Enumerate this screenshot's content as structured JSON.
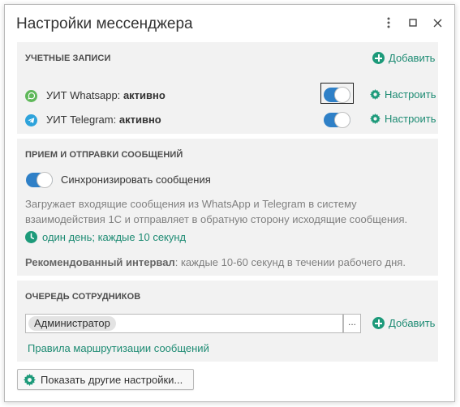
{
  "window": {
    "title": "Настройки мессенджера"
  },
  "accounts": {
    "section_title": "УЧЕТНЫЕ ЗАПИСИ",
    "add_label": "Добавить",
    "items": [
      {
        "label": "УИТ Whatsapp:",
        "status": "активно",
        "configure_label": "Настроить",
        "enabled": true,
        "icon": "whatsapp-icon",
        "icon_color": "#5fb85a"
      },
      {
        "label": "УИТ Telegram:",
        "status": "активно",
        "configure_label": "Настроить",
        "enabled": true,
        "icon": "telegram-icon",
        "icon_color": "#2ea3db"
      }
    ]
  },
  "messages": {
    "section_title": "ПРИЕМ И ОТПРАВКИ СООБЩЕНИЙ",
    "sync_label": "Синхронизировать сообщения",
    "sync_enabled": true,
    "description_line1": "Загружает входящие сообщения из WhatsApp и Telegram в систему",
    "description_line2": "взаимодействия 1С и отправляет в обратную сторону исходящие сообщения.",
    "interval_label": "один день; каждые 10 секунд",
    "recommend_bold": "Рекомендованный интервал",
    "recommend_text": ": каждые 10-60 секунд в течении рабочего дня."
  },
  "queue": {
    "section_title": "ОЧЕРЕДЬ СОТРУДНИКОВ",
    "employee_chip": "Администратор",
    "picker_label": "...",
    "add_label": "Добавить",
    "routing_link": "Правила маршрутизации сообщений"
  },
  "footer": {
    "more_settings_label": "Показать другие настройки..."
  },
  "colors": {
    "accent_green": "#1d8b73",
    "toggle_blue": "#2f80c7",
    "panel_bg": "#f2f2f2"
  }
}
